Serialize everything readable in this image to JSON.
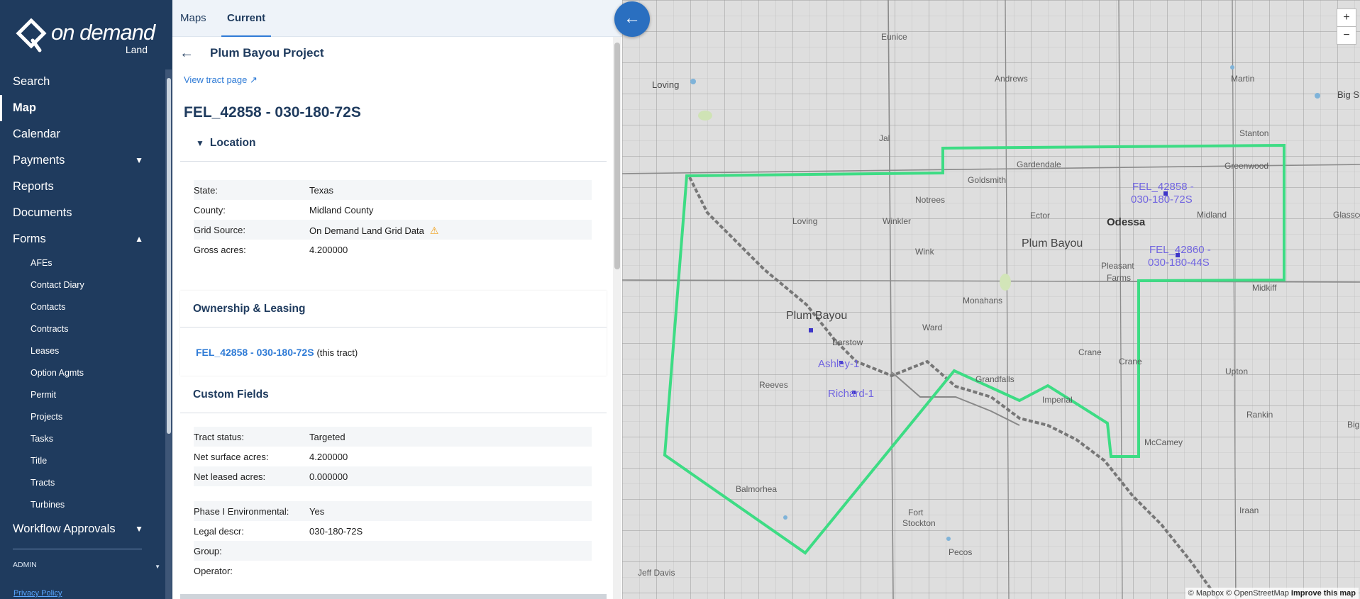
{
  "brand": {
    "name": "on demand",
    "sub": "Land"
  },
  "sidebar": {
    "items": [
      {
        "label": "Search"
      },
      {
        "label": "Map"
      },
      {
        "label": "Calendar"
      },
      {
        "label": "Payments"
      },
      {
        "label": "Reports"
      },
      {
        "label": "Documents"
      },
      {
        "label": "Forms"
      }
    ],
    "forms_items": [
      "AFEs",
      "Contact Diary",
      "Contacts",
      "Contracts",
      "Leases",
      "Option Agmts",
      "Permit",
      "Projects",
      "Tasks",
      "Title",
      "Tracts",
      "Turbines"
    ],
    "workflow": "Workflow Approvals",
    "admin": "ADMIN",
    "privacy": "Privacy Policy"
  },
  "tabs": {
    "maps": "Maps",
    "current": "Current"
  },
  "header": {
    "project": "Plum Bayou Project",
    "view_tract": "View tract page",
    "tract": "FEL_42858 - 030-180-72S"
  },
  "location": {
    "heading": "Location",
    "rows": [
      {
        "key": "State:",
        "value": "Texas"
      },
      {
        "key": "County:",
        "value": "Midland County"
      },
      {
        "key": "Grid Source:",
        "value": "On Demand Land Grid Data"
      },
      {
        "key": "Gross acres:",
        "value": "4.200000"
      }
    ]
  },
  "ownership": {
    "heading": "Ownership & Leasing",
    "link": "FEL_42858 - 030-180-72S",
    "suffix": "(this tract)"
  },
  "custom": {
    "heading": "Custom Fields",
    "rows": [
      {
        "key": "Tract status:",
        "value": "Targeted"
      },
      {
        "key": "Net surface acres:",
        "value": "4.200000"
      },
      {
        "key": "Net leased acres:",
        "value": "0.000000"
      },
      {
        "key": "Phase I Environmental:",
        "value": "Yes"
      },
      {
        "key": "Legal descr:",
        "value": "030-180-72S"
      },
      {
        "key": "Group:",
        "value": ""
      },
      {
        "key": "Operator:",
        "value": ""
      }
    ]
  },
  "map": {
    "labels": {
      "eunice": "Eunice",
      "loving1": "Loving",
      "andrews": "Andrews",
      "martin": "Martin",
      "bigs": "Big S",
      "stanton": "Stanton",
      "gardendale": "Gardendale",
      "greenwood": "Greenwood",
      "goldsmith": "Goldsmith",
      "notrees": "Notrees",
      "ector": "Ector",
      "odessa": "Odessa",
      "midland": "Midland",
      "glasscock": "Glassco",
      "loving2": "Loving",
      "winkler": "Winkler",
      "wink": "Wink",
      "plumbayou_mid": "Plum Bayou",
      "pleasant": "Pleasant",
      "farms": "Farms",
      "midkiff": "Midkiff",
      "monahans": "Monahans",
      "plumbayou_city": "Plum Bayou",
      "barstow": "Barstow",
      "ward": "Ward",
      "reeves": "Reeves",
      "grandfalls": "Grandfalls",
      "imperial": "Imperial",
      "crane1": "Crane",
      "crane2": "Crane",
      "upton": "Upton",
      "rankin": "Rankin",
      "big": "Big",
      "mccamey": "McCamey",
      "balmorhea": "Balmorhea",
      "fort": "Fort",
      "stockton": "Stockton",
      "pecos": "Pecos",
      "jeffdavis": "Jeff Davis",
      "iraan": "Iraan",
      "jal": "Jal"
    },
    "wells": {
      "w1a": "FEL_42858 -",
      "w1b": "030-180-72S",
      "w2a": "FEL_42860 -",
      "w2b": "030-180-44S",
      "w3": "Ashley-1",
      "w4": "Richard-1"
    },
    "zoom_in": "+",
    "zoom_out": "−",
    "attrib_mapbox": "© Mapbox",
    "attrib_osm": "© OpenStreetMap",
    "attrib_improve": "Improve this map"
  }
}
